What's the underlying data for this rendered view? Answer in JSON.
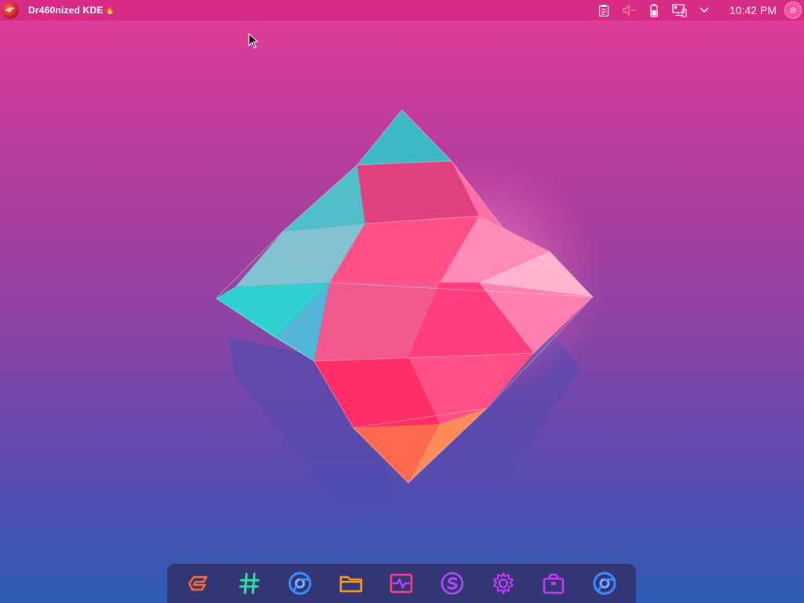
{
  "panel": {
    "app_title": "Dr460nized KDE",
    "title_emoji": "🔥",
    "launcher_icon": "garuda-eagle-icon",
    "tray": [
      {
        "name": "clipboard-icon"
      },
      {
        "name": "volume-muted-icon"
      },
      {
        "name": "battery-icon"
      },
      {
        "name": "network-icon"
      },
      {
        "name": "chevron-down-icon"
      }
    ],
    "clock": "10:42 PM",
    "avatar": "user-avatar"
  },
  "wallpaper": {
    "subject": "crystal-diamond",
    "colors": {
      "top": "#e63a98",
      "bottom": "#2d5cb4",
      "crystal_pink": "#ff3d7f",
      "crystal_cyan": "#36e0d4"
    }
  },
  "dock": {
    "items": [
      {
        "name": "garuda-gamer-icon",
        "color": "#ff6b2d"
      },
      {
        "name": "hashtag-icon",
        "color": "#2fe0a0"
      },
      {
        "name": "chromium-icon",
        "color": "#3a8cff"
      },
      {
        "name": "folder-icon",
        "color": "#ff9a1f"
      },
      {
        "name": "system-monitor-icon",
        "color": "#ff3d7f"
      },
      {
        "name": "s-app-icon",
        "color": "#b14bff"
      },
      {
        "name": "settings-gear-icon",
        "color": "#c43bff"
      },
      {
        "name": "software-store-icon",
        "color": "#c43bff"
      },
      {
        "name": "chromium-alt-icon",
        "color": "#3a8cff"
      }
    ]
  }
}
